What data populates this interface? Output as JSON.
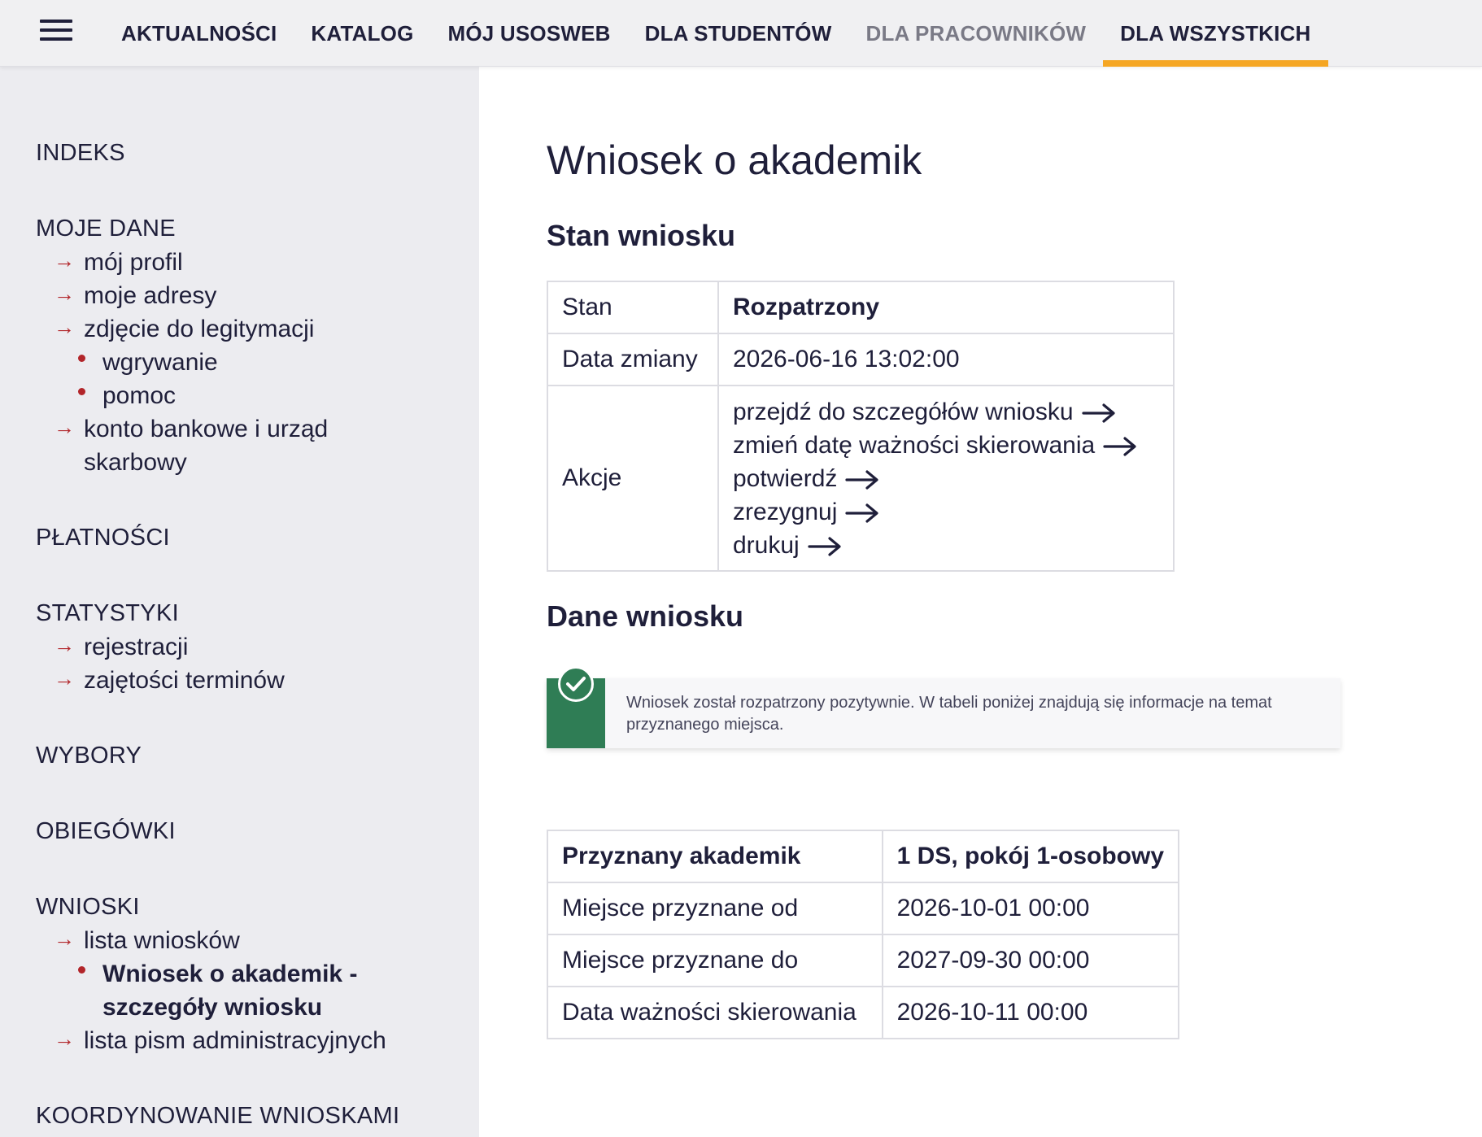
{
  "nav": {
    "items": [
      {
        "label": "AKTUALNOŚCI"
      },
      {
        "label": "KATALOG"
      },
      {
        "label": "MÓJ USOSWEB"
      },
      {
        "label": "DLA STUDENTÓW"
      },
      {
        "label": "DLA PRACOWNIKÓW"
      },
      {
        "label": "DLA WSZYSTKICH"
      }
    ],
    "active_label": "DLA WSZYSTKICH",
    "accent_color": "#f5a623"
  },
  "sidebar": {
    "indeks": "INDEKS",
    "moje_dane": {
      "label": "MOJE DANE",
      "links": [
        "mój profil",
        "moje adresy",
        "zdjęcie do legitymacji"
      ],
      "sub": [
        "wgrywanie",
        "pomoc"
      ],
      "bank": "konto bankowe i urząd skarbowy"
    },
    "platnosci": "PŁATNOŚCI",
    "statystyki": {
      "label": "STATYSTYKI",
      "links": [
        "rejestracji",
        "zajętości terminów"
      ]
    },
    "wybory": "WYBORY",
    "obiegowki": "OBIEGÓWKI",
    "wnioski": {
      "label": "WNIOSKI",
      "lista": "lista wniosków",
      "current": "Wniosek o akademik - szczegóły wniosku",
      "pisma": "lista pism administracyjnych"
    },
    "koordynowanie": "KOORDYNOWANIE WNIOSKAMI",
    "bullet_color": "#b2252a"
  },
  "main": {
    "title": "Wniosek o akademik",
    "stan_heading": "Stan wniosku",
    "stan_table": {
      "stan_label": "Stan",
      "stan_value": "Rozpatrzony",
      "data_label": "Data zmiany",
      "data_value": "2026-06-16 13:02:00",
      "akcje_label": "Akcje",
      "actions": [
        "przejdź do szczegółów wniosku",
        "zmień datę ważności skierowania",
        "potwierdź",
        "zrezygnuj",
        "drukuj"
      ]
    },
    "dane_heading": "Dane wniosku",
    "notice": {
      "text": "Wniosek został rozpatrzony pozytywnie. W tabeli poniżej znajdują się informacje na temat przyznanego miejsca.",
      "icon": "check-circle-icon",
      "color": "#2f7d55"
    },
    "przydzial_table": {
      "rows": [
        {
          "label": "Przyznany akademik",
          "value": "1 DS, pokój 1-osobowy"
        },
        {
          "label": "Miejsce przyznane od",
          "value": "2026-10-01 00:00"
        },
        {
          "label": "Miejsce przyznane do",
          "value": "2027-09-30 00:00"
        },
        {
          "label": "Data ważności skierowania",
          "value": "2026-10-11 00:00"
        }
      ]
    }
  }
}
